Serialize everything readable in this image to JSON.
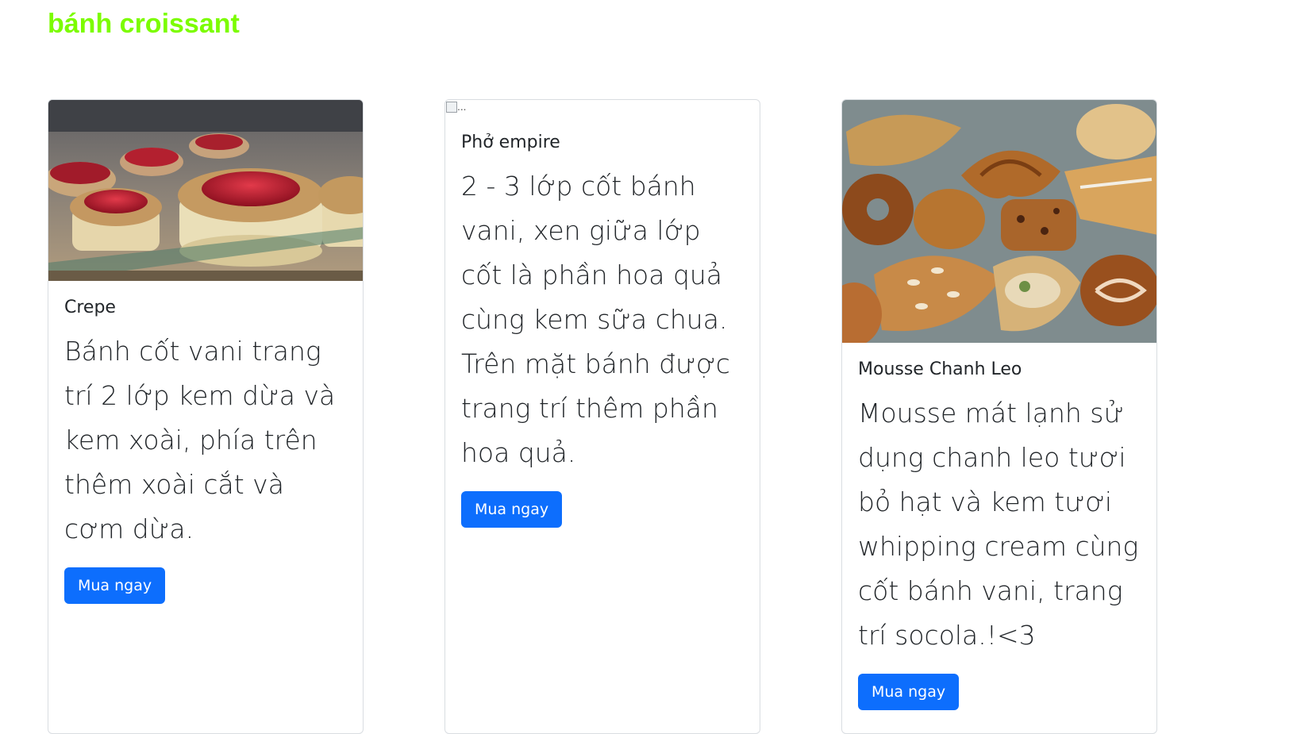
{
  "page": {
    "title": "bánh croissant",
    "title_color": "#7CFC00"
  },
  "theme": {
    "button_bg": "#0d6efd",
    "button_text": "#ffffff",
    "card_border": "#d9dde1"
  },
  "cards": [
    {
      "image_alt": "",
      "image_loaded": true,
      "title": "Crepe",
      "text": "Bánh cốt vani trang trí 2 lớp kem dừa và kem xoài, phía trên thêm xoài cắt và cơm dừa.",
      "button_label": "Mua ngay"
    },
    {
      "image_alt": "...",
      "image_loaded": false,
      "title": "Phở empire",
      "text": "2 - 3 lớp cốt bánh vani, xen giữa lớp cốt là phần hoa quả cùng kem sữa chua. Trên mặt bánh được trang trí thêm phần hoa quả.",
      "button_label": "Mua ngay"
    },
    {
      "image_alt": "",
      "image_loaded": true,
      "title": "Mousse Chanh Leo",
      "text": "Mousse mát lạnh sử dụng chanh leo tươi bỏ hạt và kem tươi whipping cream cùng cốt bánh vani, trang trí socola.!<3",
      "button_label": "Mua ngay"
    }
  ]
}
